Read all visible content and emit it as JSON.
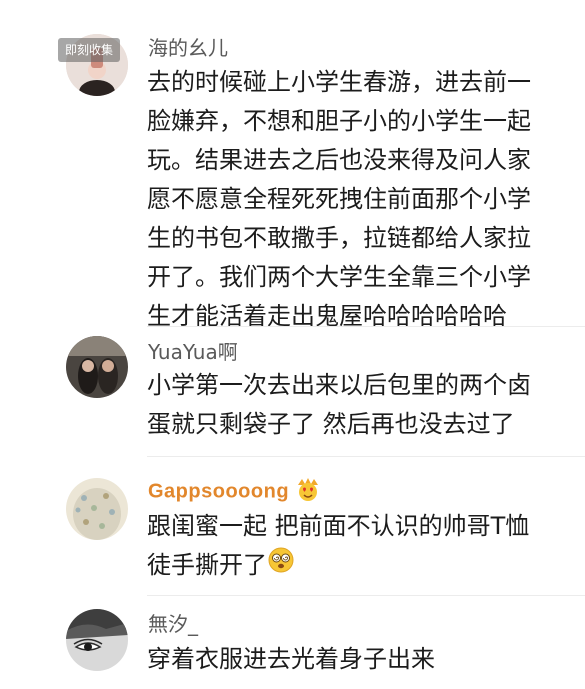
{
  "watermark": "即刻收集",
  "comments": [
    {
      "username": "海的幺儿",
      "lines": [
        "去的时候碰上小学生春游，进去前一",
        "脸嫌弃，不想和胆子小的小学生一起",
        "玩。结果进去之后也没来得及问人家",
        "愿不愿意全程死死拽住前面那个小学",
        "生的书包不敢撒手，拉链都给人家拉",
        "开了。我们两个大学生全靠三个小学",
        "生才能活着走出鬼屋哈哈哈哈哈哈"
      ]
    },
    {
      "username": "YuaYua啊",
      "lines": [
        "小学第一次去出来以后包里的两个卤",
        "蛋就只剩袋子了 然后再也没去过了"
      ]
    },
    {
      "username": "Gappsoooong",
      "badge_icon": "crown-heart-eyes-emoji",
      "lines": [
        "跟闺蜜一起 把前面不认识的帅哥T恤",
        "徒手撕开了"
      ],
      "end_icon": "dizzy-face-emoji"
    },
    {
      "username": "無汐_",
      "lines": [
        "穿着衣服进去光着身子出来"
      ]
    }
  ],
  "colors": {
    "username": "#5a5a5a",
    "vip_username": "#e2872c",
    "text": "#1c1c1c"
  }
}
